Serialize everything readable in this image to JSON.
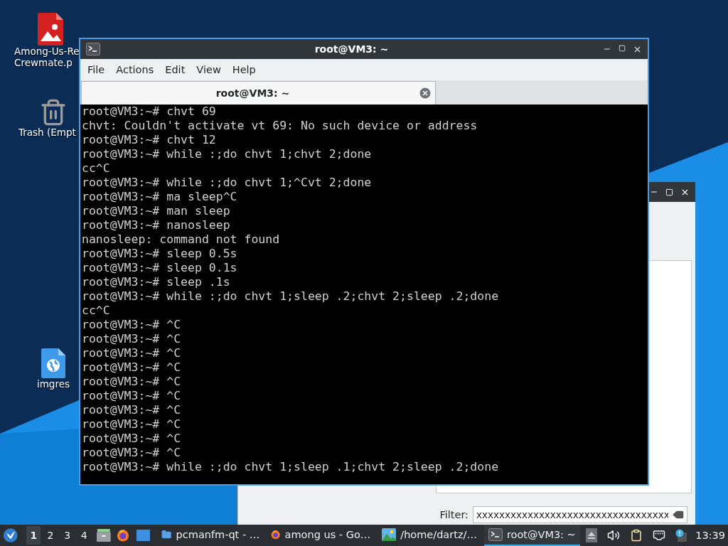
{
  "desktop": {
    "icons": [
      {
        "kind": "image",
        "label_lines": [
          "Among-Us-Re",
          "Crewmate.p"
        ]
      },
      {
        "kind": "trash",
        "label_lines": [
          "Trash (Empt"
        ]
      },
      {
        "kind": "web",
        "label_lines": [
          "imgres"
        ]
      }
    ]
  },
  "file_manager_window": {
    "filter": {
      "label": "Filter:",
      "value": "xxxxxxxxxxxxxxxxxxxxxxxxxxxxxxxxxx"
    }
  },
  "terminal_window": {
    "title": "root@VM3: ~",
    "menu": [
      "File",
      "Actions",
      "Edit",
      "View",
      "Help"
    ],
    "tabs": [
      {
        "label": "root@VM3: ~",
        "selected": true
      }
    ],
    "lines": [
      "root@VM3:~# chvt 69",
      "chvt: Couldn't activate vt 69: No such device or address",
      "root@VM3:~# chvt 12",
      "root@VM3:~# while :;do chvt 1;chvt 2;done",
      "cc^C",
      "root@VM3:~# while :;do chvt 1;^Cvt 2;done",
      "root@VM3:~# ma sleep^C",
      "root@VM3:~# man sleep",
      "root@VM3:~# nanosleep",
      "nanosleep: command not found",
      "root@VM3:~# sleep 0.5s",
      "root@VM3:~# sleep 0.1s",
      "root@VM3:~# sleep .1s",
      "root@VM3:~# while :;do chvt 1;sleep .2;chvt 2;sleep .2;done",
      "cc^C",
      "root@VM3:~# ^C",
      "root@VM3:~# ^C",
      "root@VM3:~# ^C",
      "root@VM3:~# ^C",
      "root@VM3:~# ^C",
      "root@VM3:~# ^C",
      "root@VM3:~# ^C",
      "root@VM3:~# ^C",
      "root@VM3:~# ^C",
      "root@VM3:~# ^C",
      "root@VM3:~# while :;do chvt 1;sleep .1;chvt 2;sleep .2;done"
    ]
  },
  "taskbar": {
    "desktops": [
      {
        "label": "1",
        "selected": true
      },
      {
        "label": "2",
        "selected": false
      },
      {
        "label": "3",
        "selected": false
      },
      {
        "label": "4",
        "selected": false
      }
    ],
    "tasks": [
      {
        "kind": "folder",
        "label": "pcmanfm-qt - …",
        "selected": false
      },
      {
        "kind": "browser",
        "label": "among us - Go…",
        "selected": false
      },
      {
        "kind": "image",
        "label": "/home/dartz/…",
        "selected": false
      },
      {
        "kind": "terminal",
        "label": "root@VM3: ~",
        "selected": true
      }
    ],
    "clock": "13:39"
  }
}
